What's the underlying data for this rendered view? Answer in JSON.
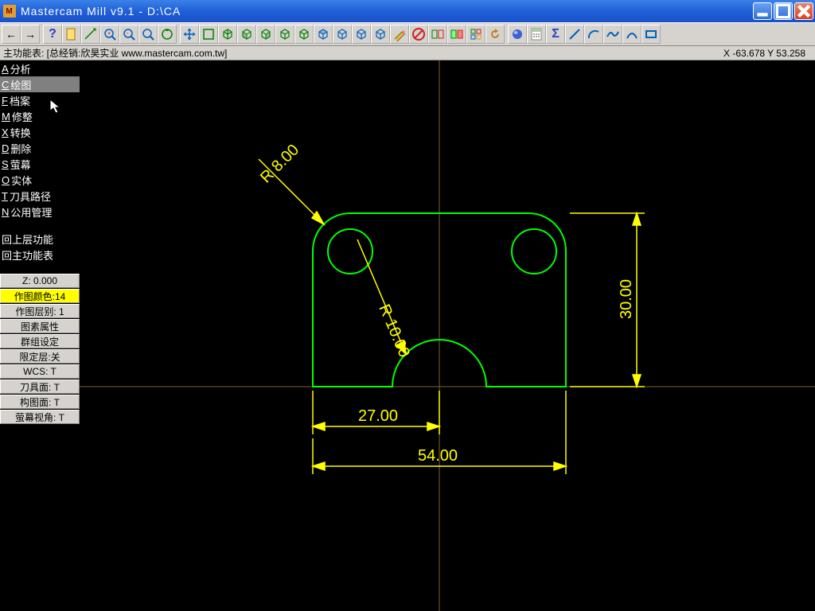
{
  "title": "Mastercam Mill v9.1 - D:\\CA",
  "appicon_text": "M",
  "infobar": {
    "label": "主功能表: [总经销:欣昊实业 www.mastercam.com.tw]",
    "coords": "X -63.678  Y 53.258"
  },
  "menu": {
    "items": [
      {
        "accel": "A",
        "label": "分析"
      },
      {
        "accel": "C",
        "label": "绘图",
        "selected": true
      },
      {
        "accel": "F",
        "label": "档案"
      },
      {
        "accel": "M",
        "label": "修整"
      },
      {
        "accel": "X",
        "label": "转换"
      },
      {
        "accel": "D",
        "label": "删除"
      },
      {
        "accel": "S",
        "label": "萤幕"
      },
      {
        "accel": "O",
        "label": "实体"
      },
      {
        "accel": "T",
        "label": "刀具路径"
      },
      {
        "accel": "N",
        "label": "公用管理"
      }
    ],
    "nav": [
      "回上层功能",
      "回主功能表"
    ]
  },
  "status": {
    "z": "Z:  0.000",
    "color": "作图颜色:14",
    "layer": "作图层别: 1",
    "attr": "图素属性",
    "group": "群组设定",
    "limit": "限定层:关",
    "wcs": "WCS:  T",
    "tool": "刀具面: T",
    "cplane": "构图面: T",
    "view": "萤幕视角: T"
  },
  "drawing": {
    "dim_r8": "R 8.00",
    "dim_r10": "R 10.00",
    "dim_27": "27.00",
    "dim_54": "54.00",
    "dim_30": "30.00"
  },
  "colors": {
    "geom": "#00ff00",
    "dim": "#ffff00",
    "axis": "#806030"
  }
}
